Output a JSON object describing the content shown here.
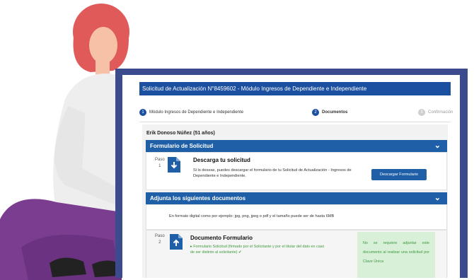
{
  "window": {
    "title": "Solicitud de Actualización N°8459602 - Módulo Ingresos de Dependiente e Independiente"
  },
  "steps": [
    {
      "num": "1",
      "label": "Módulo Ingresos de Dependiente e Independiente",
      "state": "done"
    },
    {
      "num": "2",
      "label": "Documentos",
      "state": "active"
    },
    {
      "num": "3",
      "label": "Confirmación",
      "state": "inactive"
    }
  ],
  "user": {
    "name": "Erik Donoso Núñez (51 años)"
  },
  "sections": {
    "form": {
      "title": "Formulario de Solicitud",
      "chevron": "⌄"
    },
    "docs": {
      "title": "Adjunta los siguientes documentos",
      "chevron": "⌄"
    }
  },
  "step1": {
    "paso": "Paso",
    "num": "1",
    "title": "Descarga tu solicitud",
    "text": "Si lo deseas, puedes descargar el formulario de tu Solicitud de Actualización - Ingresos de Dependiente e Independiente.",
    "button": "Descargar Formulario"
  },
  "docs_info": "En formato digital como por ejemplo: jpg, png, jpeg o pdf y el tamaño puede ser de hasta 6MB",
  "step2": {
    "paso": "Paso",
    "num": "2",
    "title": "Documento Formulario",
    "item": "Formulario Solicitud (firmado por el Solicitante y por el titular del dato en caso de ser distinto al solicitante) ✔",
    "notice": "No se requiere adjuntar este documento al realizar una solicitud por Clave Única"
  },
  "colors": {
    "frame": "#3c4a8e",
    "primary": "#1f5fa7",
    "title_bar": "#1b4fa0",
    "green_text": "#3f9a3f",
    "green_bg": "#d8efd8",
    "hair": "#e05a5a",
    "skin": "#f6c1a7",
    "pants": "#7b3d8f"
  }
}
